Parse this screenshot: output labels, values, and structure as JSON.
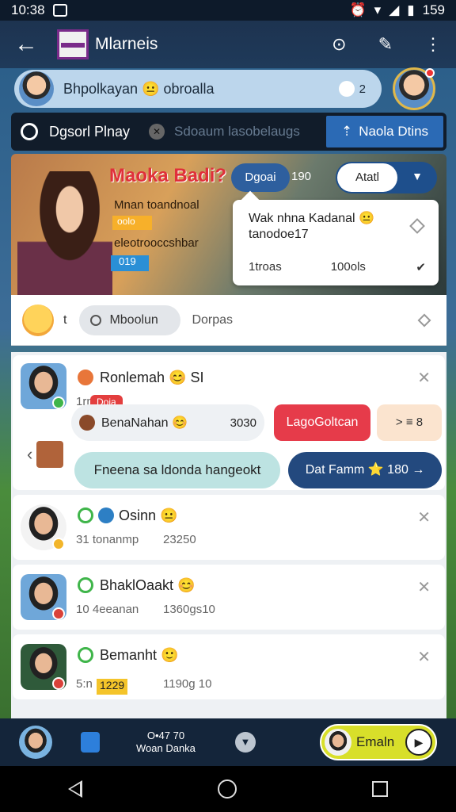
{
  "status": {
    "time": "10:38",
    "battery": "159"
  },
  "appbar": {
    "title": "Mlarneis"
  },
  "user": {
    "name": "Bhpolkayan 😐 obroalla",
    "count": "2"
  },
  "search": {
    "primary": "Dgsorl Plnay",
    "placeholder": "Sdoaum lasobelaugs",
    "action_label": "Naola Dtins"
  },
  "banner": {
    "title": "Maoka Badi?",
    "line1": "Mnan toandnoal",
    "tag_yellow": "oolo",
    "line2": "eleotrooccshbar",
    "tag_blue": "019",
    "chip_label": "Dgoai",
    "chip_num": "190",
    "segment_label": "Atatl"
  },
  "popup": {
    "message": "Wak nhna Kadanal 😐 tanodoe17",
    "foot_a": "1troas",
    "foot_b": "100ols"
  },
  "filter": {
    "plus": "t",
    "pill_label": "Mboolun",
    "second_label": "Dorpas"
  },
  "cards": [
    {
      "name": "Ronlemah 😊 SI",
      "meta": "1rn",
      "tag": "Doia",
      "inner_name": "BenaNahan 😊",
      "inner_num": "3030",
      "btn_red": "LagoGoltcan",
      "btn_peach": "> ≡ 8",
      "bubble": "Fneena sa ldonda hangeokt",
      "dark_btn": "Dat Famm ⭐ 180 →"
    },
    {
      "name": "Osinn 😐",
      "meta": "31 tonanmp",
      "meta2": "23250"
    },
    {
      "name": "BhaklOaakt 😊",
      "meta": "10 4eeanan",
      "meta2": "1360gs10"
    },
    {
      "name": "Bemanht 🙂",
      "meta": "5:n",
      "tag": "1229",
      "meta2": "1190g 10"
    }
  ],
  "bottom": {
    "mid_top": "O•47 70",
    "mid_bottom": "Woan Danka",
    "cta": "Emaln"
  },
  "colors": {
    "accent": "#2b6ab5",
    "danger": "#e63b4a",
    "cta": "#d8df2a"
  }
}
